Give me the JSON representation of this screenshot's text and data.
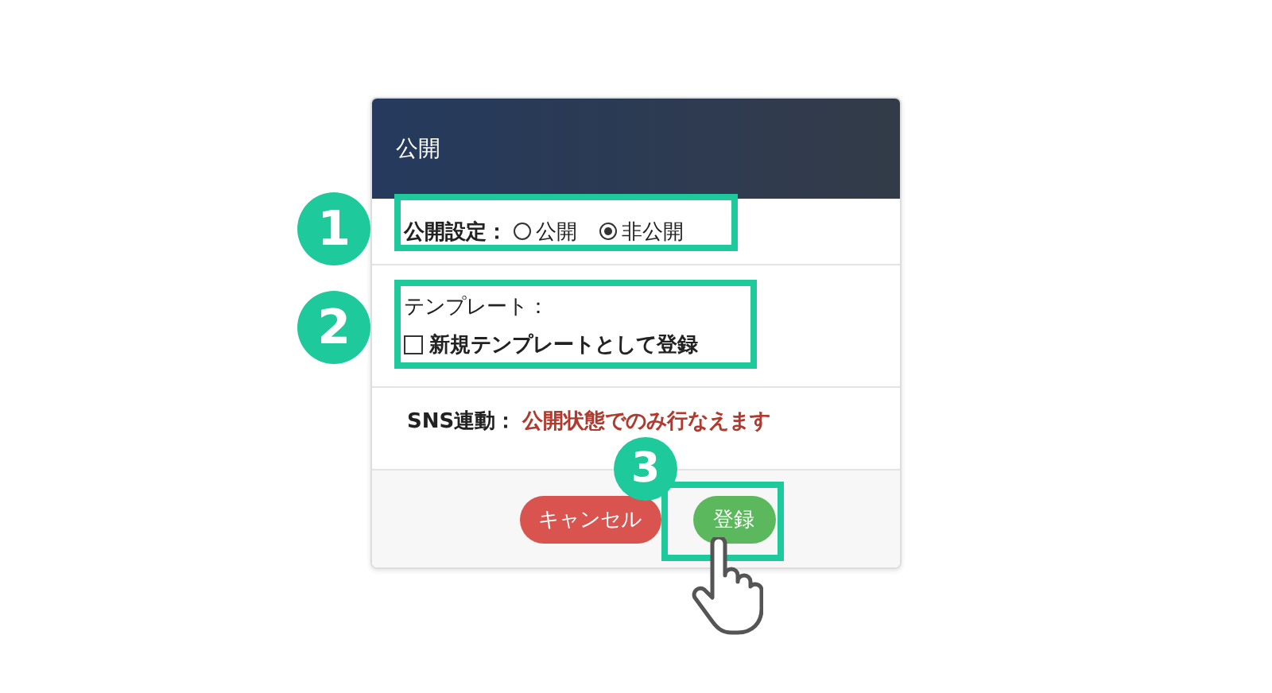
{
  "panel": {
    "title": "公開"
  },
  "visibility": {
    "label": "公開設定：",
    "options": [
      {
        "label": "公開",
        "selected": false
      },
      {
        "label": "非公開",
        "selected": true
      }
    ]
  },
  "template": {
    "label": "テンプレート：",
    "checkbox": {
      "label": "新規テンプレートとして登録",
      "checked": false
    }
  },
  "sns": {
    "label": "SNS連動：",
    "message": "公開状態でのみ行なえます"
  },
  "buttons": [
    {
      "label": "キャンセル",
      "kind": "danger"
    },
    {
      "label": "登録",
      "kind": "success"
    }
  ],
  "annotations": [
    {
      "number": "1"
    },
    {
      "number": "2"
    },
    {
      "number": "3"
    }
  ]
}
